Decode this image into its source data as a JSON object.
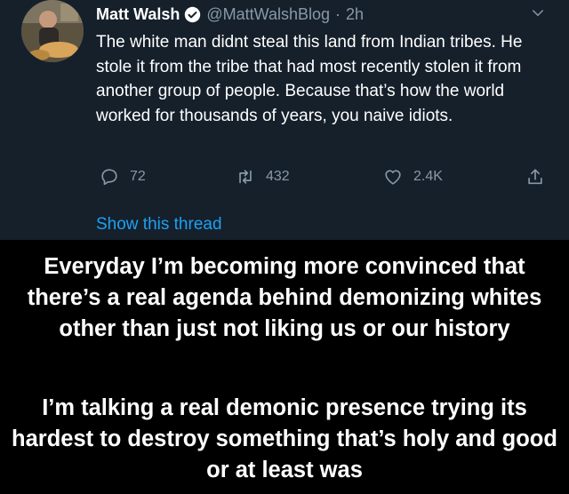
{
  "tweet": {
    "author_name": "Matt Walsh",
    "handle": "@MattWalshBlog",
    "separator": "·",
    "time": "2h",
    "text": "The white man didnt steal this land from Indian tribes. He stole it from the tribe that had most recently stolen it from another group of people. Because that’s how the world worked for thousands of years, you naive idiots.",
    "replies": "72",
    "retweets": "432",
    "likes": "2.4K",
    "show_thread": "Show this thread",
    "colors": {
      "background": "#15202b",
      "secondary_text": "#8899a6",
      "link": "#1da1f2",
      "verified": "#1da1f2"
    },
    "icons": [
      "verified-badge-icon",
      "chevron-down-icon",
      "reply-icon",
      "retweet-icon",
      "like-icon",
      "share-icon"
    ]
  },
  "caption": {
    "paragraph1": "Everyday I’m becoming more convinced that there’s a real agenda behind demonizing whites other than just not liking us or our history",
    "paragraph2": "I’m talking a real demonic presence trying its hardest to destroy something that’s holy and good or at least was"
  }
}
